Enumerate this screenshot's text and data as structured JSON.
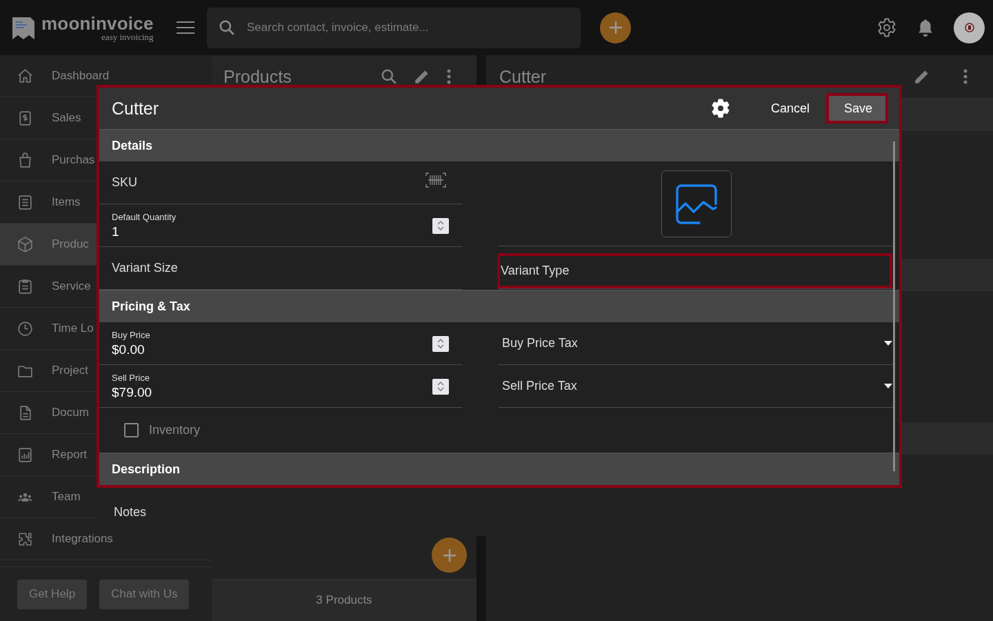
{
  "topbar": {
    "logo": {
      "name": "mooninvoice",
      "tagline": "easy invoicing"
    },
    "search": {
      "placeholder": "Search contact, invoice, estimate..."
    }
  },
  "sidebar": {
    "items": [
      {
        "label": "Dashboard",
        "selected": false
      },
      {
        "label": "Sales",
        "selected": false
      },
      {
        "label": "Purchas",
        "selected": false
      },
      {
        "label": "Items",
        "selected": false
      },
      {
        "label": "Produc",
        "selected": true
      },
      {
        "label": "Service",
        "selected": false
      },
      {
        "label": "Time Lo",
        "selected": false
      },
      {
        "label": "Project",
        "selected": false
      },
      {
        "label": "Docum",
        "selected": false
      },
      {
        "label": "Report",
        "selected": false
      },
      {
        "label": "Team",
        "selected": false
      },
      {
        "label": "Integrations",
        "selected": false
      }
    ],
    "buttons": [
      "Get Help",
      "Chat with Us"
    ]
  },
  "products_panel": {
    "title": "Products",
    "footer": "3 Products"
  },
  "detail_panel": {
    "title": "Cutter"
  },
  "dialog": {
    "title": "Cutter",
    "highlighted": true,
    "buttons": [
      {
        "label": "Cancel",
        "kind": "text",
        "highlighted": false
      },
      {
        "label": "Save",
        "kind": "filled",
        "highlighted": true
      }
    ],
    "sections": [
      {
        "title": "Details",
        "left": [
          {
            "kind": "scan",
            "placeholder": "SKU"
          },
          {
            "kind": "number",
            "label": "Default Quantity",
            "value": "1"
          },
          {
            "kind": "text",
            "placeholder": "Variant Size",
            "highlighted": false
          }
        ],
        "right": [
          {
            "kind": "image"
          },
          {
            "kind": "text",
            "placeholder": "Variant Type",
            "highlighted": true
          }
        ]
      },
      {
        "title": "Pricing & Tax",
        "left": [
          {
            "kind": "number",
            "label": "Buy Price",
            "value": "$0.00"
          },
          {
            "kind": "number",
            "label": "Sell Price",
            "value": "$79.00"
          },
          {
            "kind": "checkbox",
            "label": "Inventory",
            "checked": false
          }
        ],
        "right": [
          {
            "kind": "select",
            "placeholder": "Buy Price Tax"
          },
          {
            "kind": "select",
            "placeholder": "Sell Price Tax"
          }
        ]
      },
      {
        "title": "Description"
      }
    ],
    "notes": {
      "placeholder": "Notes"
    }
  }
}
